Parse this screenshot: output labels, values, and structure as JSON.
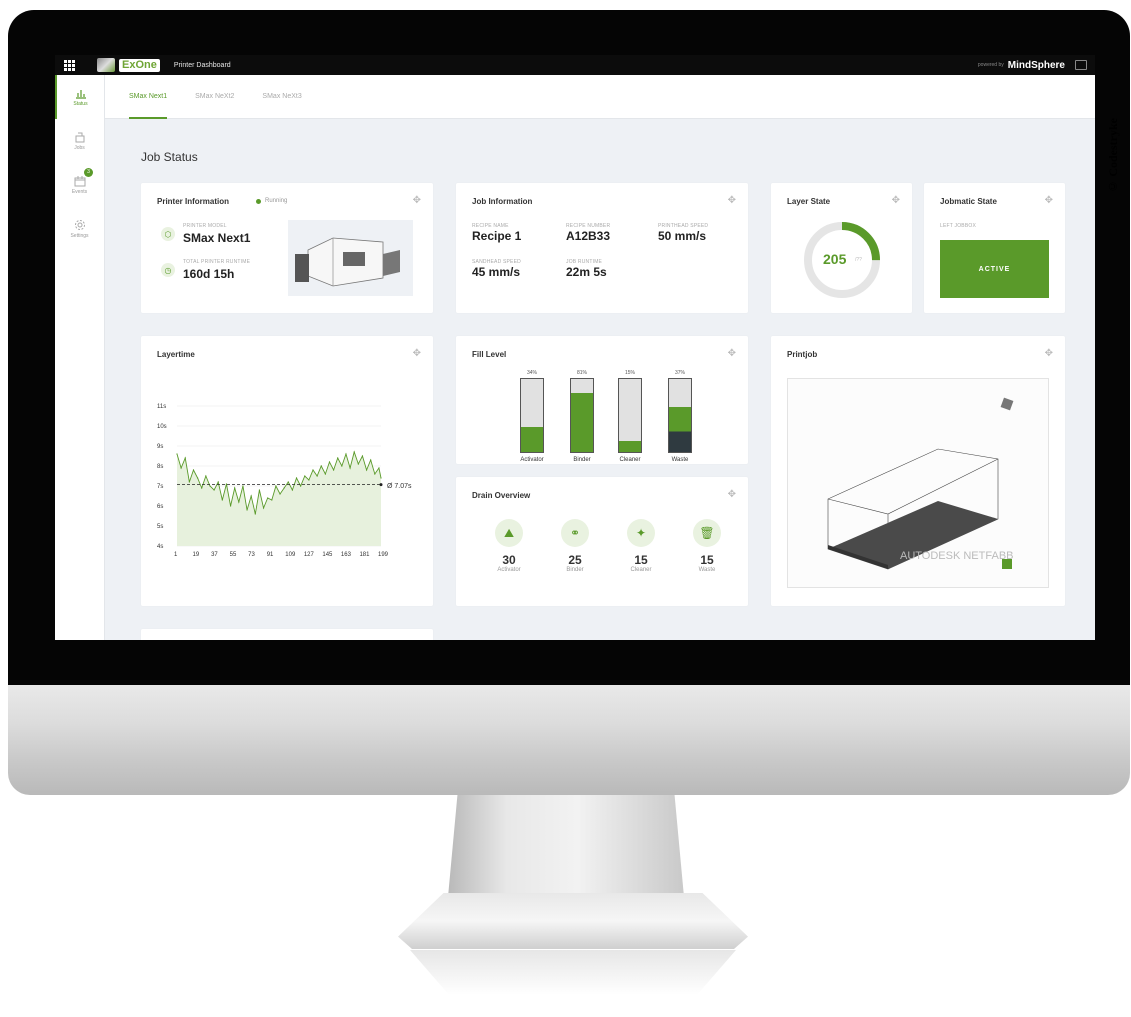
{
  "copyright": "© Codestryke",
  "topbar": {
    "brand": "ExOne",
    "app_title": "Printer Dashboard",
    "powered_by": "powered by",
    "mindsphere": "MindSphere"
  },
  "sidebar": {
    "items": [
      {
        "label": "Status",
        "icon": "bar-chart-icon",
        "active": true
      },
      {
        "label": "Jobs",
        "icon": "printer-tray-icon"
      },
      {
        "label": "Events",
        "icon": "calendar-icon",
        "badge": "3"
      },
      {
        "label": "Settings",
        "icon": "gear-icon"
      }
    ]
  },
  "tabs": [
    {
      "label": "SMax Next1",
      "active": true
    },
    {
      "label": "SMax NeXt2"
    },
    {
      "label": "SMax NeXt3"
    }
  ],
  "page_title": "Job Status",
  "printer_info": {
    "title": "Printer Information",
    "status": "Running",
    "model_label": "PRINTER MODEL",
    "model": "SMax Next1",
    "runtime_label": "TOTAL PRINTER RUNTIME",
    "runtime": "160d 15h"
  },
  "job_info": {
    "title": "Job Information",
    "fields": [
      {
        "label": "RECIPE NAME",
        "value": "Recipe 1"
      },
      {
        "label": "RECIPE NUMBER",
        "value": "A12B33"
      },
      {
        "label": "PRINTHEAD SPEED",
        "value": "50 mm/s"
      },
      {
        "label": "SANDHEAD SPEED",
        "value": "45 mm/s"
      },
      {
        "label": "JOB RUNTIME",
        "value": "22m 5s"
      }
    ]
  },
  "layer_state": {
    "title": "Layer State",
    "value": "205",
    "unit": "/??",
    "progress": 0.25
  },
  "jobmatic": {
    "title": "Jobmatic State",
    "label": "LEFT JOBBOX",
    "state": "ACTIVE"
  },
  "layertime": {
    "title": "Layertime",
    "avg_label": "Ø 7.07s",
    "chart_data": {
      "type": "line",
      "title": "Layertime",
      "y_ticks": [
        "11s",
        "10s",
        "9s",
        "8s",
        "7s",
        "6s",
        "5s",
        "4s"
      ],
      "x_ticks": [
        "1",
        "19",
        "37",
        "55",
        "73",
        "91",
        "109",
        "127",
        "145",
        "163",
        "181",
        "199"
      ],
      "ylim": [
        4,
        11
      ],
      "xlim": [
        1,
        199
      ],
      "average": 7.07,
      "series": [
        {
          "x": [
            1,
            5,
            9,
            13,
            17,
            21,
            25,
            29,
            33,
            37,
            41,
            45,
            49,
            53,
            57,
            61,
            65,
            69,
            73,
            77,
            81,
            85,
            89,
            93,
            97,
            101,
            105,
            109,
            113,
            117,
            121,
            125,
            129,
            133,
            137,
            141,
            145,
            149,
            153,
            157,
            161,
            165,
            169,
            173,
            177,
            181,
            185,
            189,
            193,
            197,
            199
          ],
          "values": [
            8.6,
            7.9,
            8.4,
            7.2,
            7.8,
            7.4,
            6.9,
            7.5,
            7.0,
            6.8,
            7.2,
            6.3,
            7.1,
            6.0,
            6.9,
            6.2,
            7.0,
            5.8,
            6.5,
            5.6,
            6.8,
            5.9,
            6.4,
            6.3,
            7.0,
            6.6,
            6.9,
            7.2,
            6.8,
            7.4,
            7.0,
            7.5,
            7.3,
            7.8,
            7.5,
            8.0,
            7.6,
            8.2,
            7.8,
            8.4,
            8.0,
            8.6,
            7.9,
            8.7,
            8.1,
            8.5,
            7.8,
            8.3,
            7.6,
            7.9,
            7.4
          ]
        }
      ]
    }
  },
  "fill_level": {
    "title": "Fill Level",
    "chart_data": {
      "type": "bar",
      "categories": [
        "Activator",
        "Binder",
        "Cleaner",
        "Waste"
      ],
      "values": [
        34,
        81,
        15,
        37
      ],
      "labels": [
        "34%",
        "81%",
        "15%",
        "37%"
      ]
    }
  },
  "drain": {
    "title": "Drain Overview",
    "items": [
      {
        "value": "30",
        "label": "Activator",
        "icon": "activator-icon"
      },
      {
        "value": "25",
        "label": "Binder",
        "icon": "binder-icon"
      },
      {
        "value": "15",
        "label": "Cleaner",
        "icon": "cleaner-icon"
      },
      {
        "value": "15",
        "label": "Waste",
        "icon": "waste-icon"
      }
    ]
  },
  "printjob": {
    "title": "Printjob",
    "watermark": "AUTODESK NETFABB"
  },
  "colors": {
    "accent": "#5a9a2a",
    "dark": "#2f3a40",
    "bar_empty": "#e1e1e1"
  }
}
